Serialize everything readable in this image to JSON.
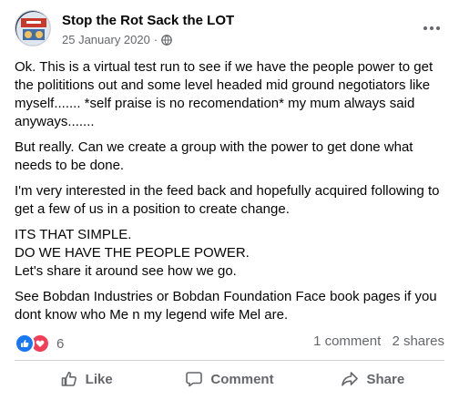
{
  "post": {
    "page_name": "Stop the Rot Sack the LOT",
    "date": "25 January 2020",
    "separator": "·",
    "avatar_text": "SACK THE LOT"
  },
  "body": {
    "paragraphs": [
      "Ok. This is a virtual test run to see if we have the people power to get the polititions out and some level headed mid ground negotiators like myself....... *self praise is no recomendation* my mum always said anyways.......",
      "But really. Can we create a group with the power to get done what needs to be done.",
      "I'm very interested in the feed back and hopefully acquired following to get a few of us in a position to create change.",
      "ITS THAT SIMPLE.\nDO WE HAVE THE PEOPLE POWER.\nLet's share it around see how we go.",
      "See Bobdan Industries or Bobdan Foundation Face book pages if you dont know who Me n my legend wife Mel are."
    ]
  },
  "stats": {
    "reaction_count": "6",
    "comments": "1 comment",
    "shares": "2 shares"
  },
  "actions": {
    "like": "Like",
    "comment": "Comment",
    "share": "Share"
  },
  "colors": {
    "like_blue": "#1877f2",
    "love_red": "#f33e58",
    "secondary_text": "#65676b"
  },
  "icons": {
    "privacy": "globe-icon",
    "menu": "more-icon",
    "like": "thumbs-up-icon",
    "comment": "comment-bubble-icon",
    "share": "share-arrow-icon"
  }
}
